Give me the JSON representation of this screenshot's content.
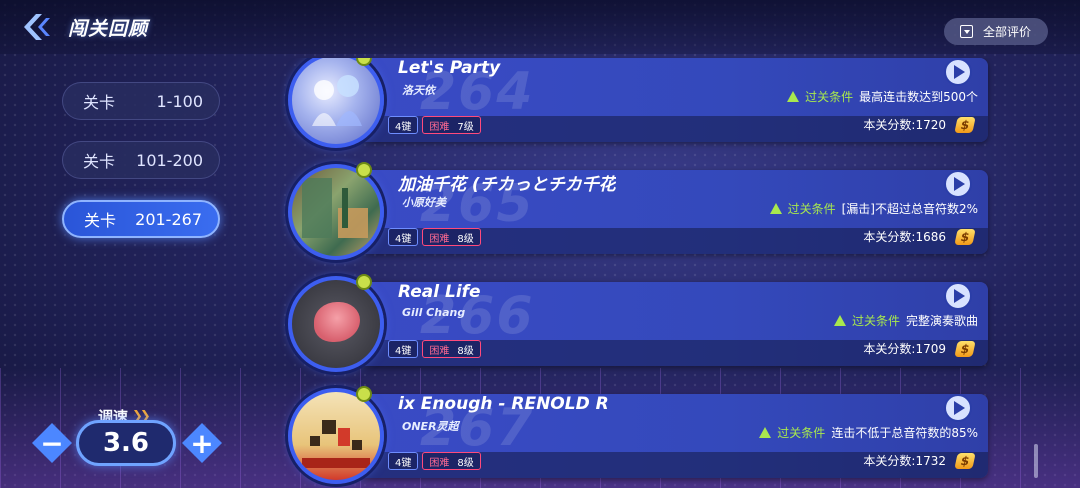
{
  "header": {
    "title": "闯关回顾",
    "rate_all_label": "全部评价"
  },
  "level_tabs": [
    {
      "label": "关卡",
      "range": "1-100",
      "active": false
    },
    {
      "label": "关卡",
      "range": "101-200",
      "active": false
    },
    {
      "label": "关卡",
      "range": "201-267",
      "active": true
    }
  ],
  "speed": {
    "label": "调速",
    "value": "3.6",
    "minus": "−",
    "plus": "+"
  },
  "colors": {
    "accent": "#3a6df0",
    "pass": "#a8e84e",
    "difficulty": "#ff4a7c"
  },
  "songs": [
    {
      "number": "264",
      "title": "Let's Party",
      "artist": "洛天依",
      "keys": "4键",
      "difficulty": "困难",
      "level": "7级",
      "pass_label": "过关条件",
      "pass_text": "最高连击数达到500个",
      "score": "本关分数:1720",
      "cover_icon": "anime-album-cover"
    },
    {
      "number": "265",
      "title": "加油千花 (チカっとチカ千花",
      "artist": "小原好美",
      "keys": "4键",
      "difficulty": "困难",
      "level": "8级",
      "pass_label": "过关条件",
      "pass_text": "[漏击]不超过总音符数2%",
      "score": "本关分数:1686",
      "cover_icon": "room-album-cover"
    },
    {
      "number": "266",
      "title": "Real Life",
      "artist": "Gill Chang",
      "keys": "4键",
      "difficulty": "困难",
      "level": "8级",
      "pass_label": "过关条件",
      "pass_text": "完整演奏歌曲",
      "score": "本关分数:1709",
      "cover_icon": "pink-blob-album-cover"
    },
    {
      "number": "267",
      "title": "ix   Enough - RENOLD R",
      "artist": "ONER灵超",
      "keys": "4键",
      "difficulty": "困难",
      "level": "8级",
      "pass_label": "过关条件",
      "pass_text": "连击不低于总音符数的85%",
      "score": "本关分数:1732",
      "cover_icon": "pixel-art-album-cover"
    }
  ]
}
